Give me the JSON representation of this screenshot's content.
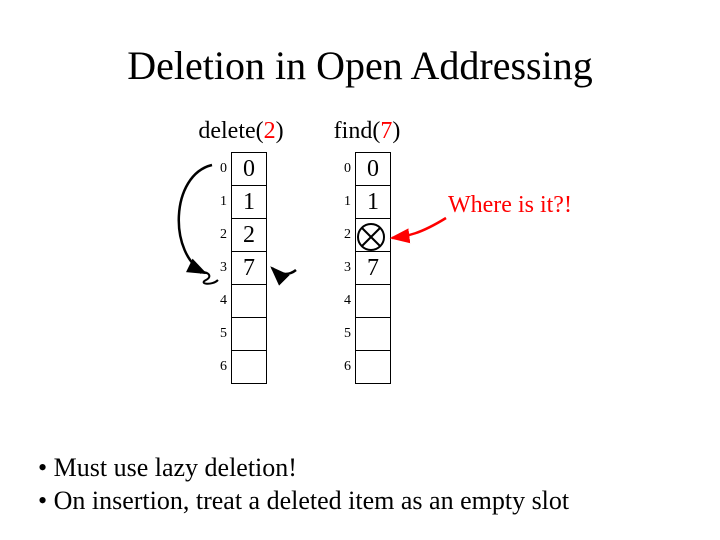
{
  "title": "Deletion in Open Addressing",
  "left": {
    "header_prefix": "delete(",
    "header_arg": "2",
    "header_suffix": ")",
    "indices": [
      "0",
      "1",
      "2",
      "3",
      "4",
      "5",
      "6"
    ],
    "cells": [
      "0",
      "1",
      "2",
      "7",
      "",
      "",
      ""
    ]
  },
  "right": {
    "header_prefix": "find(",
    "header_arg": "7",
    "header_suffix": ")",
    "indices": [
      "0",
      "1",
      "2",
      "3",
      "4",
      "5",
      "6"
    ],
    "cells": [
      "0",
      "1",
      "",
      "7",
      "",
      "",
      ""
    ]
  },
  "annotation": "Where is it?!",
  "bullets": [
    "Must use lazy deletion!",
    "On insertion, treat a deleted item as an empty slot"
  ]
}
